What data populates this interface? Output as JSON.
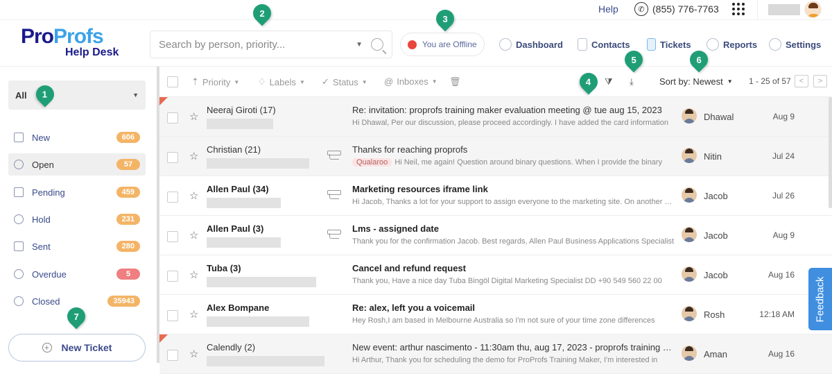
{
  "topbar": {
    "help_label": "Help",
    "phone": "(855) 776-7763",
    "phone_icon": "phone-icon",
    "apps_icon": "grid-icon"
  },
  "header": {
    "logo_pro": "Pro",
    "logo_profs": "Profs",
    "logo_sub": "Help Desk",
    "search_placeholder": "Search by person, priority...",
    "offline_label": "You are Offline",
    "status_color": "#e8473b",
    "nav": [
      {
        "label": "Dashboard",
        "icon": "gauge-icon"
      },
      {
        "label": "Contacts",
        "icon": "contact-card-icon"
      },
      {
        "label": "Tickets",
        "icon": "ticket-icon"
      },
      {
        "label": "Reports",
        "icon": "pie-chart-icon"
      },
      {
        "label": "Settings",
        "icon": "gear-icon"
      }
    ]
  },
  "sidebar": {
    "filter_value": "All",
    "items": [
      {
        "label": "New",
        "count": "606",
        "icon": "inbox-icon",
        "badge_color": "#f4b466"
      },
      {
        "label": "Open",
        "count": "57",
        "icon": "open-envelope-icon",
        "badge_color": "#f4b466",
        "active": true
      },
      {
        "label": "Pending",
        "count": "459",
        "icon": "hourglass-icon",
        "badge_color": "#f4b466"
      },
      {
        "label": "Hold",
        "count": "231",
        "icon": "pause-icon",
        "badge_color": "#f4b466"
      },
      {
        "label": "Sent",
        "count": "280",
        "icon": "sent-icon",
        "badge_color": "#f4b466"
      },
      {
        "label": "Overdue",
        "count": "5",
        "icon": "clock-icon",
        "badge_color": "#ef7f80"
      },
      {
        "label": "Closed",
        "count": "35943",
        "icon": "check-circle-icon",
        "badge_color": "#f4b466"
      }
    ],
    "new_ticket_label": "New Ticket"
  },
  "toolbar": {
    "filters": [
      {
        "label": "Priority",
        "icon": "priority-icon"
      },
      {
        "label": "Labels",
        "icon": "label-icon"
      },
      {
        "label": "Status",
        "icon": "status-icon"
      },
      {
        "label": "Inboxes",
        "icon": "at-icon"
      }
    ],
    "sort_label": "Sort by: Newest",
    "pagination": "1 - 25 of 57",
    "prev": "<",
    "next": ">"
  },
  "tickets": [
    {
      "sender": "Neeraj Giroti (17)",
      "subject": "Re: invitation: proprofs training maker evaluation meeting @ tue aug 15, 2023",
      "preview": "Hi Dhawal, Per our discussion, please proceed accordingly. I have added the card information",
      "agent": "Dhawal",
      "date": "Aug 9",
      "unread": false,
      "flag": true,
      "thread": false,
      "tag": ""
    },
    {
      "sender": "Christian (21)",
      "subject": "Thanks for reaching proprofs",
      "preview": "Hi Neil, me again! Question around binary questions. When I provide the binary",
      "agent": "Nitin",
      "date": "Jul 24",
      "unread": false,
      "flag": false,
      "thread": true,
      "tag": "Qualaroo"
    },
    {
      "sender": "Allen Paul (34)",
      "subject": "Marketing resources iframe link",
      "preview": "Hi Jacob, Thanks a lot for your support to assign everyone to the marketing site. On another note",
      "agent": "Jacob",
      "date": "Jul 26",
      "unread": true,
      "flag": false,
      "thread": true,
      "tag": ""
    },
    {
      "sender": "Allen Paul (3)",
      "subject": "Lms - assigned date",
      "preview": "Thank you for the confirmation Jacob. Best regards, Allen Paul Business Applications Specialist",
      "agent": "Jacob",
      "date": "Aug 9",
      "unread": true,
      "flag": false,
      "thread": true,
      "tag": ""
    },
    {
      "sender": "Tuba (3)",
      "subject": "Cancel and refund request",
      "preview": "Thank you, Have a nice day Tuba Bingöl Digital Marketing Specialist DD +90 549 560 22 00",
      "agent": "Jacob",
      "date": "Aug 16",
      "unread": true,
      "flag": false,
      "thread": false,
      "tag": ""
    },
    {
      "sender": "Alex Bompane",
      "subject": "Re: alex, left you a voicemail",
      "preview": "Hey Rosh,I am based in Melbourne Australia so I'm not sure of your time zone differences",
      "agent": "Rosh",
      "date": "12:18 AM",
      "unread": true,
      "flag": false,
      "thread": false,
      "tag": ""
    },
    {
      "sender": "Calendly (2)",
      "subject": "New event: arthur nascimento - 11:30am thu, aug 17, 2023 - proprofs training maker",
      "preview": "Hi Arthur, Thank you for scheduling the demo for ProProfs Training Maker, I'm interested in",
      "agent": "Aman",
      "date": "Aug 16",
      "unread": false,
      "flag": true,
      "thread": false,
      "tag": ""
    }
  ],
  "feedback_label": "Feedback",
  "markers": [
    "1",
    "2",
    "3",
    "4",
    "5",
    "6",
    "7"
  ]
}
